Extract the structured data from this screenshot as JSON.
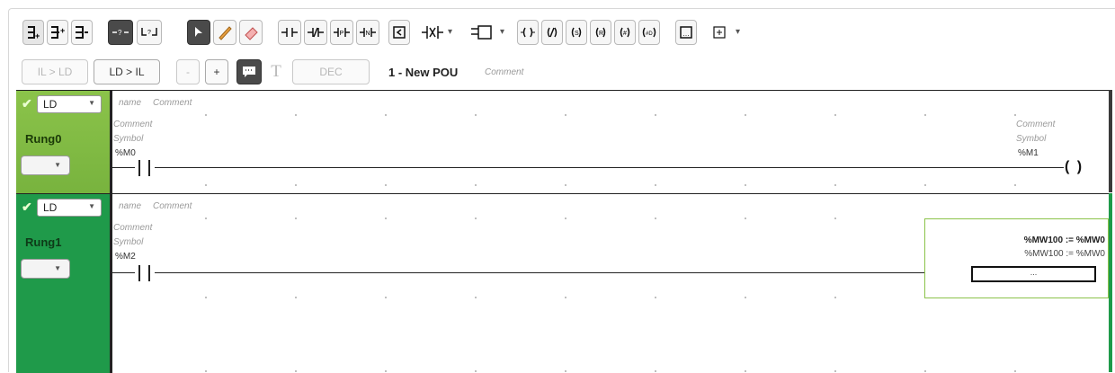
{
  "toolbar": {
    "il_to_ld": "IL > LD",
    "ld_to_il": "LD > IL",
    "minus": "-",
    "plus": "+",
    "text_tool": "T",
    "dec": "DEC"
  },
  "pou": {
    "title": "1 - New POU",
    "comment": "Comment"
  },
  "rungs": [
    {
      "name": "Rung0",
      "language": "LD",
      "header_name": "name",
      "header_comment": "Comment",
      "contact": {
        "comment": "Comment",
        "symbol": "Symbol",
        "address": "%M0"
      },
      "coil": {
        "comment": "Comment",
        "symbol": "Symbol",
        "address": "%M1",
        "glyph": "( )"
      }
    },
    {
      "name": "Rung1",
      "language": "LD",
      "header_name": "name",
      "header_comment": "Comment",
      "contact": {
        "comment": "Comment",
        "symbol": "Symbol",
        "address": "%M2"
      },
      "operation": {
        "title": "%MW100 := %MW0",
        "subtitle": "%MW100 := %MW0",
        "block_text": "..."
      }
    }
  ]
}
